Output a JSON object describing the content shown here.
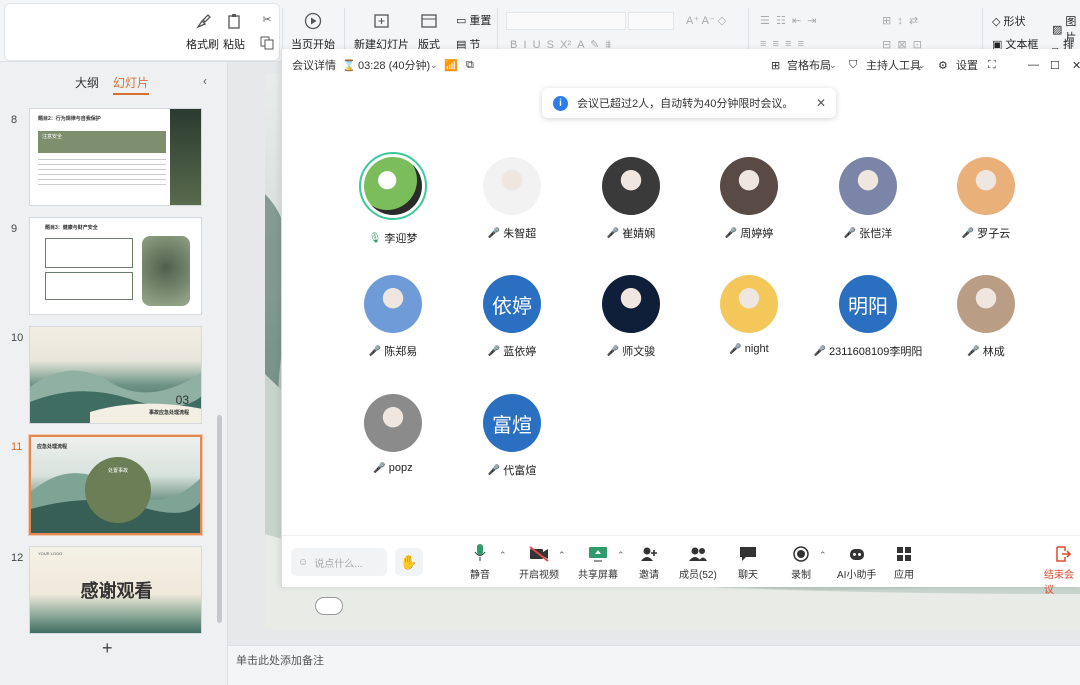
{
  "ribbon": {
    "format_painter": "格式刷",
    "paste": "粘贴",
    "from_current": "当页开始",
    "new_slide": "新建幻灯片",
    "layout": "版式",
    "reset": "重置",
    "section": "节",
    "shape": "形状",
    "textbox": "文本框",
    "image": "图片",
    "arrange": "排列"
  },
  "leftpanel": {
    "tab_outline": "大纲",
    "tab_slides": "幻灯片",
    "add_label": "+",
    "slides": [
      {
        "num": "8",
        "title": "题目2：行为规律与自我保护",
        "sub": "注意安全"
      },
      {
        "num": "9",
        "title": "题目3：健康与财产安全"
      },
      {
        "num": "10",
        "big": "03",
        "title": "事故应急处理流程"
      },
      {
        "num": "11",
        "title": "应急处理流程",
        "circle": "处置事故"
      },
      {
        "num": "12",
        "title": "感谢观看",
        "tag": "YOUR LOGO"
      }
    ]
  },
  "notes": {
    "placeholder": "单击此处添加备注"
  },
  "meeting": {
    "details": "会议详情",
    "timer": "03:28 (40分钟)",
    "layout": "宫格布局",
    "host_tools": "主持人工具",
    "settings": "设置",
    "banner": "会议已超过2人，自动转为40分钟限时会议。",
    "participants": [
      {
        "name": "李迎梦",
        "type": "img",
        "color": "#7bbd5a",
        "active": true
      },
      {
        "name": "朱智超",
        "type": "img",
        "color": "#f2f2f2"
      },
      {
        "name": "崔婧娴",
        "type": "img",
        "color": "#3a3a3a"
      },
      {
        "name": "周婷婷",
        "type": "img",
        "color": "#5a4a45"
      },
      {
        "name": "张恺洋",
        "type": "img",
        "color": "#7a85a8"
      },
      {
        "name": "罗子云",
        "type": "img",
        "color": "#e9b07a"
      },
      {
        "name": "陈郑易",
        "type": "img",
        "color": "#6f9cd8"
      },
      {
        "name": "蓝依婷",
        "type": "text",
        "text": "依婷"
      },
      {
        "name": "师文骏",
        "type": "img",
        "color": "#0f1f3a"
      },
      {
        "name": "night",
        "type": "img",
        "color": "#f3c75a"
      },
      {
        "name": "2311608109李明阳",
        "type": "text",
        "text": "明阳"
      },
      {
        "name": "林成",
        "type": "img",
        "color": "#b99e85"
      },
      {
        "name": "popz",
        "type": "img",
        "color": "#8b8b8b"
      },
      {
        "name": "代富煊",
        "type": "text",
        "text": "富煊"
      }
    ],
    "controls": {
      "chat_placeholder": "说点什么...",
      "mute": "静音",
      "video": "开启视频",
      "share": "共享屏幕",
      "invite": "邀请",
      "members": "成员(52)",
      "chat": "聊天",
      "record": "录制",
      "ai": "AI小助手",
      "apps": "应用",
      "end": "结束会议"
    }
  }
}
